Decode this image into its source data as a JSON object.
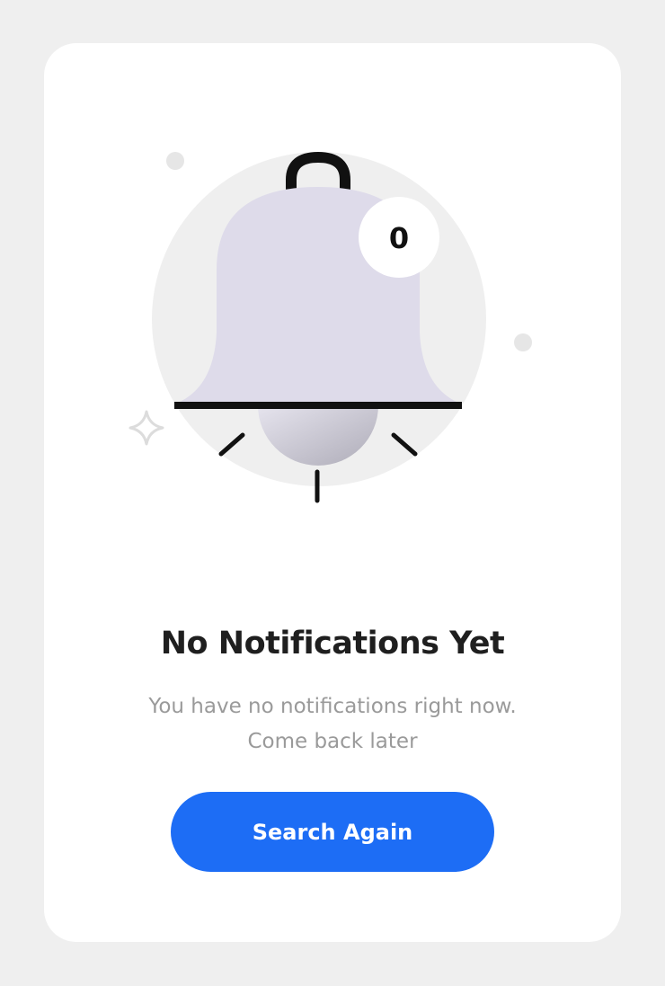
{
  "empty_state": {
    "title": "No Notifications Yet",
    "message_line1": "You have no notifications right now.",
    "message_line2": "Come back later",
    "button_label": "Search Again"
  },
  "badge": {
    "count": "0"
  },
  "icons": {
    "main": "bell-icon",
    "sparkle": "sparkle-icon"
  },
  "colors": {
    "background": "#efefef",
    "card": "#ffffff",
    "bell_body": "#dedbea",
    "halo": "#efefef",
    "button": "#1d6df5",
    "title_text": "#1f1f1f",
    "message_text": "#9a9a9a"
  }
}
